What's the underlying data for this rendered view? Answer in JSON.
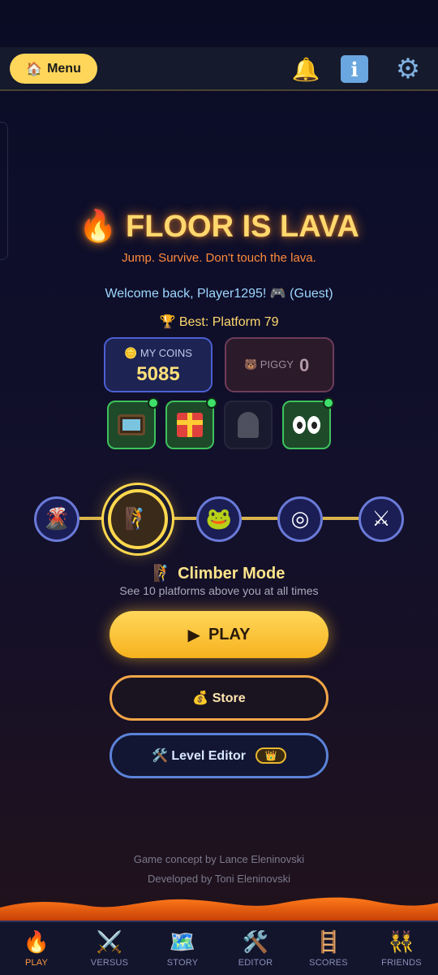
{
  "topbar": {
    "menu_icon": "house-icon",
    "menu_label": "Menu",
    "icons": [
      "bell-icon",
      "info-icon",
      "gear-icon"
    ],
    "info_glyph": "i"
  },
  "hero": {
    "title_icon": "fire-icon",
    "title": "FLOOR IS LAVA",
    "subtitle": "Jump. Survive. Don't touch the lava.",
    "welcome": "Welcome back, Player1295! 🎮 (Guest)",
    "best": "🏆 Best: Platform 79"
  },
  "wallet": {
    "coins_label": "🪙 MY COINS",
    "coins_value": "5085",
    "piggy_label": "🐻 PIGGY",
    "piggy_value": "0"
  },
  "powerups": [
    {
      "name": "tv-icon",
      "active": true
    },
    {
      "name": "gift-icon",
      "active": true
    },
    {
      "name": "tombstone-icon",
      "active": false
    },
    {
      "name": "eyes-icon",
      "active": true
    }
  ],
  "modes": {
    "icons": [
      "volcano-icon",
      "climber-icon",
      "frog-icon",
      "target-icon",
      "swords-icon"
    ],
    "selected_index": 1,
    "selected_name": "🧗 Climber Mode",
    "selected_desc": "See 10 platforms above you at all times"
  },
  "actions": {
    "play_label": "PLAY",
    "store_label": "💰 Store",
    "editor_label": "🛠️ Level Editor",
    "editor_badge": "👑"
  },
  "credits": {
    "line1": "Game concept by Lance Eleninovski",
    "line2": "Developed by Toni Eleninovski"
  },
  "nav": [
    {
      "label": "PLAY",
      "icon": "fire-icon",
      "glyph": "🔥",
      "active": true
    },
    {
      "label": "VERSUS",
      "icon": "swords-icon",
      "glyph": "⚔️",
      "active": false
    },
    {
      "label": "STORY",
      "icon": "map-icon",
      "glyph": "🗺️",
      "active": false
    },
    {
      "label": "EDITOR",
      "icon": "tools-icon",
      "glyph": "🛠️",
      "active": false
    },
    {
      "label": "SCORES",
      "icon": "ladder-icon",
      "glyph": "🪜",
      "active": false
    },
    {
      "label": "FRIENDS",
      "icon": "people-icon",
      "glyph": "👯",
      "active": false
    }
  ],
  "colors": {
    "accent_gold": "#ffd65a",
    "lava_orange": "#ff8a3c",
    "active_green": "#3ec25c",
    "mode_blue": "#6a7ad8"
  }
}
